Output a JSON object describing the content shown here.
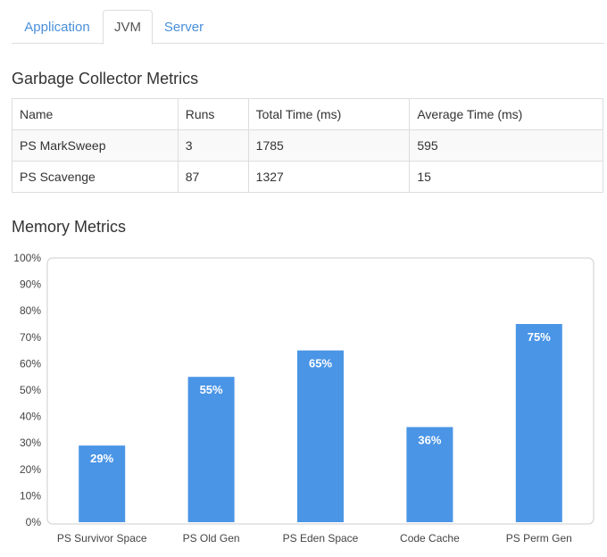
{
  "tabs": [
    {
      "label": "Application",
      "active": false
    },
    {
      "label": "JVM",
      "active": true
    },
    {
      "label": "Server",
      "active": false
    }
  ],
  "gc": {
    "title": "Garbage Collector Metrics",
    "columns": [
      "Name",
      "Runs",
      "Total Time (ms)",
      "Average Time (ms)"
    ],
    "rows": [
      [
        "PS MarkSweep",
        "3",
        "1785",
        "595"
      ],
      [
        "PS Scavenge",
        "87",
        "1327",
        "15"
      ]
    ]
  },
  "memory": {
    "title": "Memory Metrics"
  },
  "colors": {
    "bar": "#4a95e6",
    "link": "#4a8fd9"
  },
  "chart_data": {
    "type": "bar",
    "categories": [
      "PS Survivor Space",
      "PS Old Gen",
      "PS Eden Space",
      "Code Cache",
      "PS Perm Gen"
    ],
    "values": [
      29,
      55,
      65,
      36,
      75
    ],
    "data_labels": [
      "29%",
      "55%",
      "65%",
      "36%",
      "75%"
    ],
    "yticks": [
      "0%",
      "10%",
      "20%",
      "30%",
      "40%",
      "50%",
      "60%",
      "70%",
      "80%",
      "90%",
      "100%"
    ],
    "ylim": [
      0,
      100
    ],
    "title": "",
    "xlabel": "",
    "ylabel": "",
    "grid": false
  }
}
